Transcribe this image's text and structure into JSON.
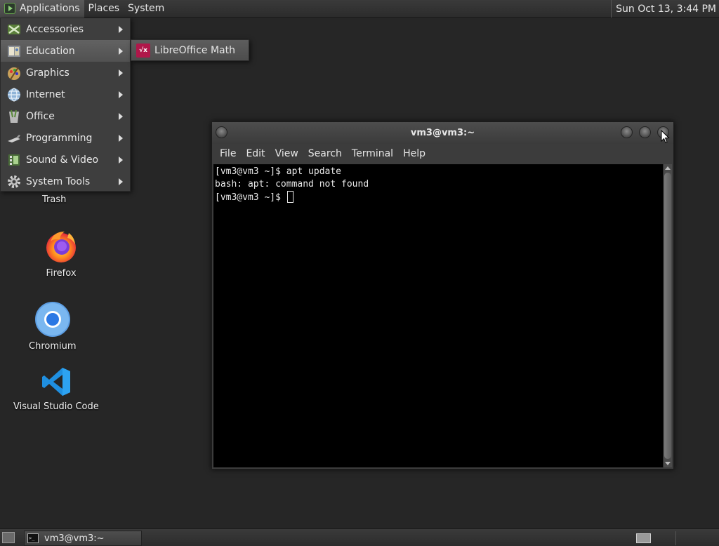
{
  "top_panel": {
    "menus": [
      "Applications",
      "Places",
      "System"
    ],
    "clock": "Sun Oct 13,  3:44 PM"
  },
  "app_menu": {
    "items": [
      {
        "label": "Accessories",
        "icon": "accessories-icon"
      },
      {
        "label": "Education",
        "icon": "education-icon"
      },
      {
        "label": "Graphics",
        "icon": "graphics-icon"
      },
      {
        "label": "Internet",
        "icon": "internet-icon"
      },
      {
        "label": "Office",
        "icon": "office-icon"
      },
      {
        "label": "Programming",
        "icon": "programming-icon"
      },
      {
        "label": "Sound & Video",
        "icon": "sound-video-icon"
      },
      {
        "label": "System Tools",
        "icon": "system-tools-icon"
      }
    ],
    "selected": "Education",
    "submenu": {
      "label": "LibreOffice Math",
      "icon": "libreoffice-math-icon"
    }
  },
  "desktop": {
    "icons": [
      {
        "label": "Trash",
        "icon": "trash-icon"
      },
      {
        "label": "Firefox",
        "icon": "firefox-icon"
      },
      {
        "label": "Chromium",
        "icon": "chromium-icon"
      },
      {
        "label": "Visual Studio Code",
        "icon": "vscode-icon"
      }
    ]
  },
  "terminal": {
    "title": "vm3@vm3:~",
    "menus": [
      "File",
      "Edit",
      "View",
      "Search",
      "Terminal",
      "Help"
    ],
    "lines": [
      "[vm3@vm3 ~]$ apt update",
      "bash: apt: command not found",
      "[vm3@vm3 ~]$ "
    ],
    "background": "#000000",
    "foreground": "#e8e8e8"
  },
  "bottom_panel": {
    "tasks": [
      {
        "label": "vm3@vm3:~",
        "icon": "terminal-icon"
      }
    ]
  }
}
